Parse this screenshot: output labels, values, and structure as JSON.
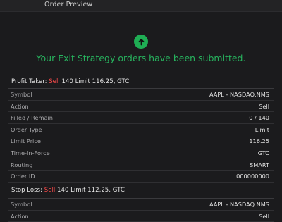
{
  "window": {
    "title": "Order Preview"
  },
  "success": {
    "icon": "arrow-up-icon",
    "message": "Your Exit Strategy orders have been submitted."
  },
  "profit_taker": {
    "title_prefix": "Profit Taker: ",
    "side": "Sell",
    "title_suffix": " 140 Limit 116.25, GTC",
    "rows": [
      {
        "label": "Symbol",
        "value": "AAPL - NASDAQ.NMS"
      },
      {
        "label": "Action",
        "value": "Sell"
      },
      {
        "label": "Filled / Remain",
        "value": "0 / 140"
      },
      {
        "label": "Order Type",
        "value": "Limit"
      },
      {
        "label": "Limit Price",
        "value": "116.25"
      },
      {
        "label": "Time-In-Force",
        "value": "GTC"
      },
      {
        "label": "Routing",
        "value": "SMART"
      },
      {
        "label": "Order ID",
        "value": "000000000"
      }
    ]
  },
  "stop_loss": {
    "title_prefix": "Stop Loss: ",
    "side": "Sell",
    "title_suffix": " 140 Limit 112.25, GTC",
    "rows": [
      {
        "label": "Symbol",
        "value": "AAPL - NASDAQ.NMS"
      },
      {
        "label": "Action",
        "value": "Sell"
      }
    ]
  },
  "colors": {
    "success": "#27b35e",
    "sell": "#ff4b4b",
    "background": "#1b1b1d"
  }
}
